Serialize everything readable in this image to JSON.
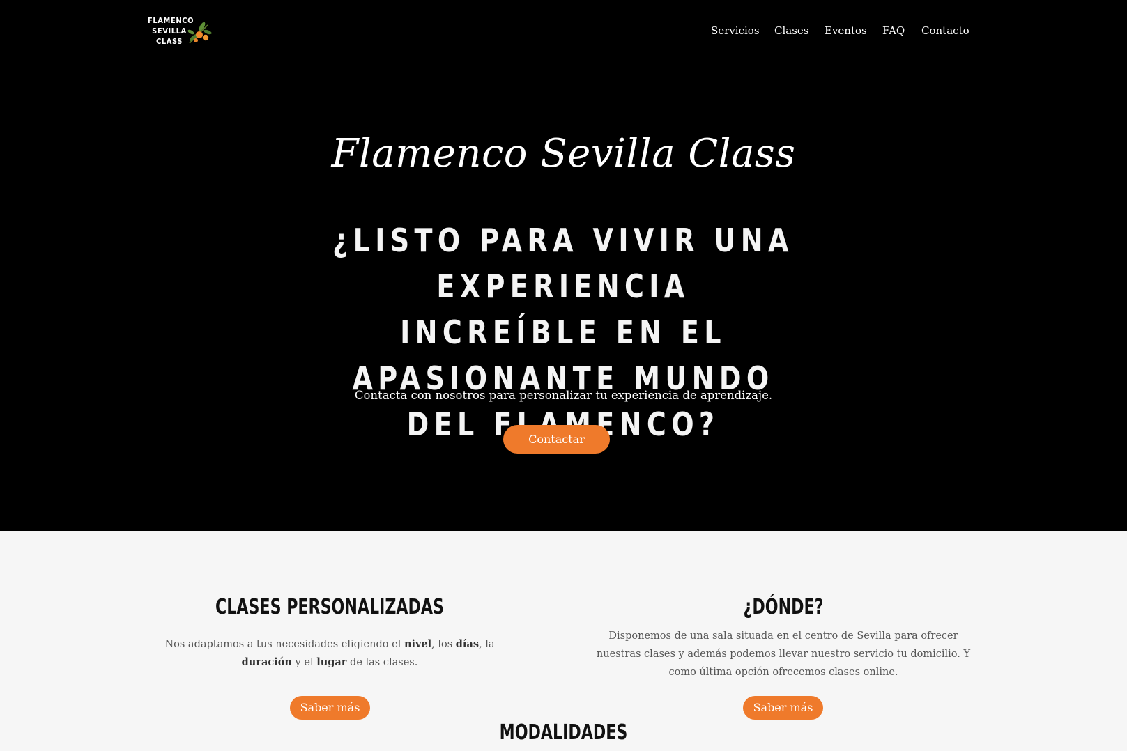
{
  "brand": {
    "logo_lines": [
      "FLAMENCO",
      "SEVILLA",
      "CLASS"
    ]
  },
  "nav": {
    "items": [
      {
        "label": "Servicios"
      },
      {
        "label": "Clases"
      },
      {
        "label": "Eventos"
      },
      {
        "label": "FAQ"
      },
      {
        "label": "Contacto"
      }
    ]
  },
  "hero": {
    "script_title": "Flamenco Sevilla Class",
    "headline_lines": [
      "¿LISTO PARA VIVIR UNA EXPERIENCIA",
      "INCREÍBLE EN EL APASIONANTE MUNDO",
      "DEL FLAMENCO?"
    ],
    "subtitle": "Contacta con nosotros para personalizar tu experiencia de aprendizaje.",
    "cta_label": "Contactar"
  },
  "features": {
    "left": {
      "title": "CLASES PERSONALIZADAS",
      "text_parts": [
        "Nos adaptamos a tus necesidades eligiendo el ",
        "nivel",
        ", los ",
        "días",
        ", la ",
        "duración",
        " y el ",
        "lugar",
        " de las clases."
      ],
      "button_label": "Saber más"
    },
    "right": {
      "title": "¿DÓNDE?",
      "text": "Disponemos de una sala situada en el centro de Sevilla para ofrecer nuestras clases y además podemos llevar nuestro servicio tu domicilio. Y como última opción ofrecemos clases online.",
      "button_label": "Saber más"
    }
  },
  "modalidades": {
    "title": "MODALIDADES"
  },
  "colors": {
    "accent": "#ef7a2b",
    "hero_bg": "#000000",
    "section_bg": "#f6f6f6"
  }
}
